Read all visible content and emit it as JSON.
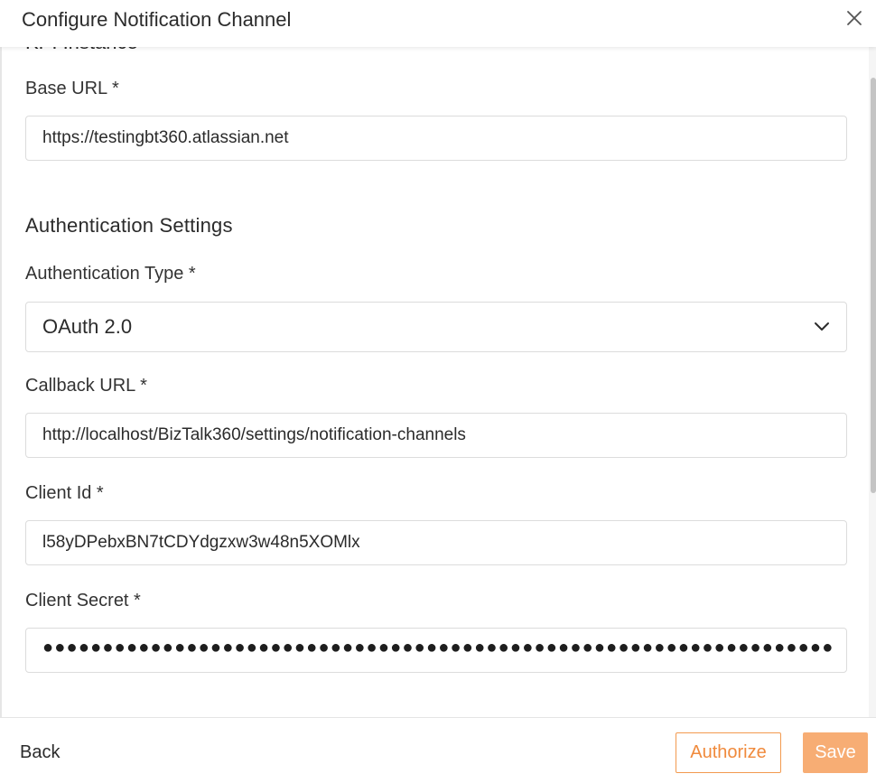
{
  "dialog": {
    "title": "Configure Notification Channel",
    "close_icon": "close-icon"
  },
  "form": {
    "clipped_section_heading": "KPI Instance",
    "base_url": {
      "label": "Base URL *",
      "value": "https://testingbt360.atlassian.net"
    },
    "auth_section_heading": "Authentication Settings",
    "auth_type": {
      "label": "Authentication Type *",
      "selected": "OAuth 2.0",
      "icon": "chevron-down-icon"
    },
    "callback_url": {
      "label": "Callback URL *",
      "value": "http://localhost/BizTalk360/settings/notification-channels"
    },
    "client_id": {
      "label": "Client Id *",
      "value": "l58yDPebxBN7tCDYdgzxw3w48n5XOMlx"
    },
    "client_secret": {
      "label": "Client Secret *",
      "masked_value": "●●●●●●●●●●●●●●●●●●●●●●●●●●●●●●●●●●●●●●●●●●●●●●●●●●●●●●●●●●●●●●●●●●●●●●●●●●●●●●●●●●●●●●●●●●●●●●"
    }
  },
  "footer": {
    "back_label": "Back",
    "authorize_label": "Authorize",
    "save_label": "Save"
  },
  "colors": {
    "accent": "#f08a3c",
    "save_bg": "#f7ad74",
    "border": "#dcdcdc"
  }
}
